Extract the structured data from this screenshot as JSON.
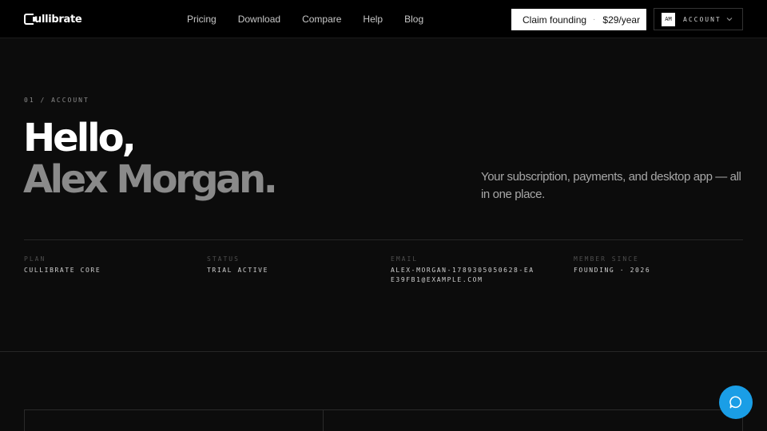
{
  "brand": {
    "mark": "C",
    "name": "ullibrate"
  },
  "nav": [
    "Pricing",
    "Download",
    "Compare",
    "Help",
    "Blog"
  ],
  "claim": {
    "label": "Claim founding",
    "separator": "·",
    "price": "$29/year"
  },
  "account": {
    "initials": "AM",
    "label": "ACCOUNT"
  },
  "hero": {
    "eyebrow": "01 / ACCOUNT",
    "greeting": "Hello,",
    "name": "Alex Morgan.",
    "tagline": "Your subscription, payments, and desktop app — all in one place."
  },
  "info": [
    {
      "label": "PLAN",
      "value": "CULLIBRATE CORE"
    },
    {
      "label": "STATUS",
      "value": "TRIAL ACTIVE"
    },
    {
      "label": "EMAIL",
      "value": "ALEX-MORGAN-1789305050628-EAE39FB1@EXAMPLE.COM"
    },
    {
      "label": "MEMBER SINCE",
      "value": "FOUNDING · 2026"
    }
  ],
  "colors": {
    "accent": "#1a9ee6",
    "background": "#0c0c0c",
    "muted": "#8a8a8a"
  },
  "icons": {
    "chevron": "chevron-down-icon",
    "chat": "chat-bubble-icon"
  }
}
